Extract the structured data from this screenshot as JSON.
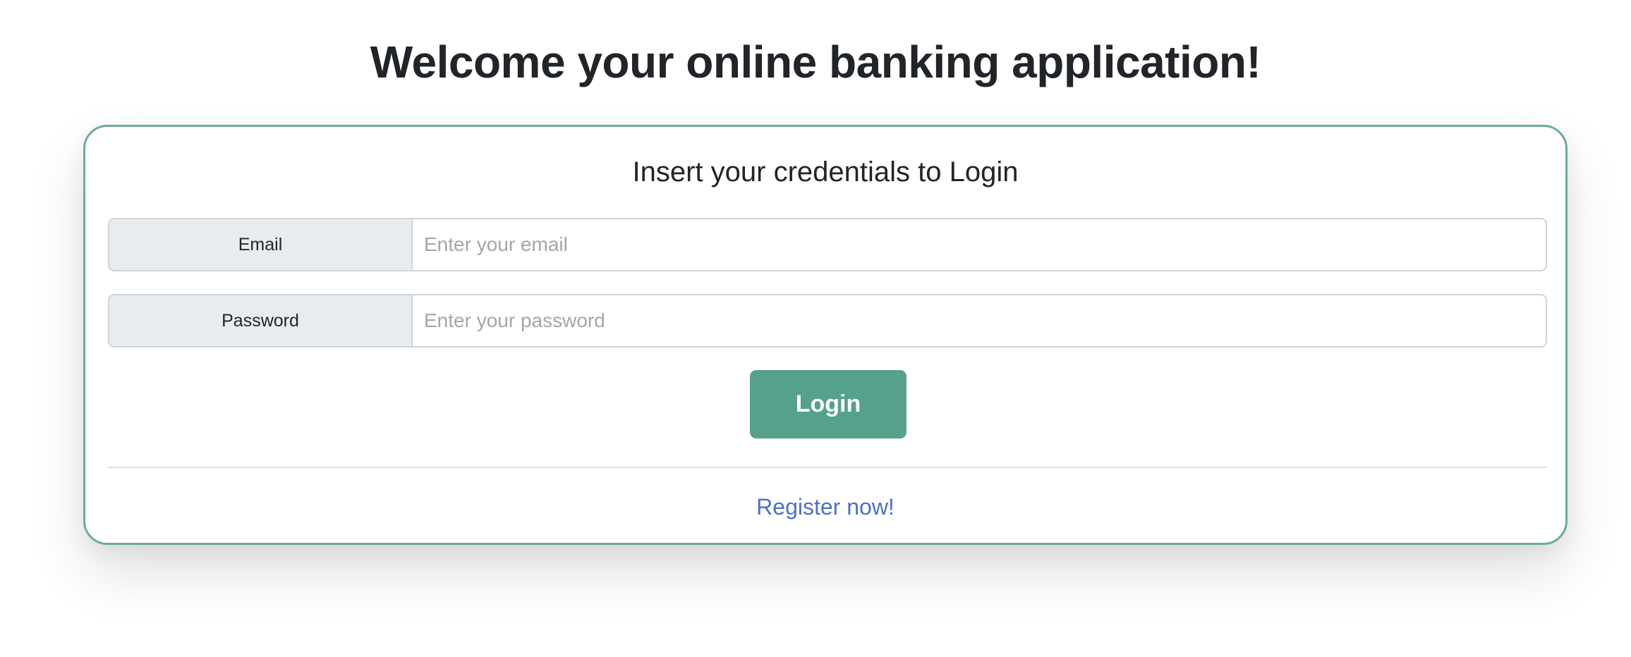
{
  "page": {
    "title": "Welcome your online banking application!"
  },
  "login_card": {
    "heading": "Insert your credentials to Login",
    "email": {
      "label": "Email",
      "value": "",
      "placeholder": "Enter your email"
    },
    "password": {
      "label": "Password",
      "value": "",
      "placeholder": "Enter your password"
    },
    "login_button_label": "Login",
    "register_link_label": "Register now!"
  },
  "colors": {
    "accent": "#56a18b",
    "card_border": "#6aad97",
    "link": "#4e6fcf",
    "label_background": "#e9ecef"
  }
}
